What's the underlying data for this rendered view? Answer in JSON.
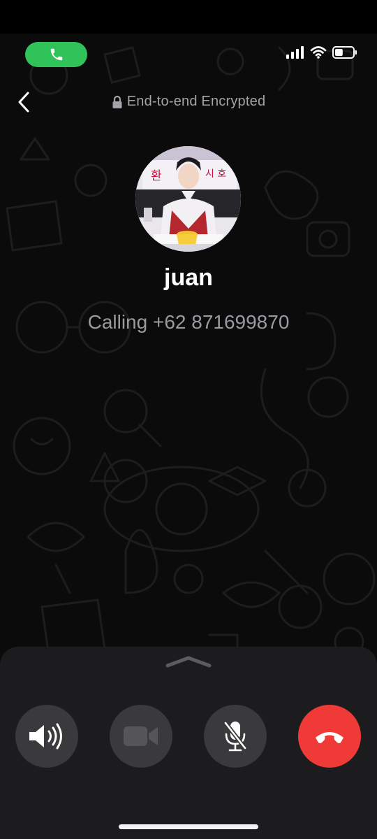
{
  "status_bar": {
    "call_indicator_icon": "phone-icon",
    "call_indicator_color": "#30c35a",
    "signal_icon": "cellular-signal-icon",
    "wifi_icon": "wifi-icon",
    "battery_icon": "battery-icon",
    "battery_level": 0.45
  },
  "header": {
    "back_icon": "chevron-left-icon",
    "encryption_label": "End-to-end Encrypted"
  },
  "contact": {
    "name": "juan",
    "call_status": "Calling +62 871699870"
  },
  "controls": {
    "speaker_icon": "speaker-icon",
    "video_icon": "video-camera-icon",
    "mute_icon": "microphone-muted-icon",
    "end_call_icon": "end-call-icon",
    "end_call_color": "#f03a37"
  },
  "panel": {
    "handle_icon": "chevron-up-icon"
  }
}
